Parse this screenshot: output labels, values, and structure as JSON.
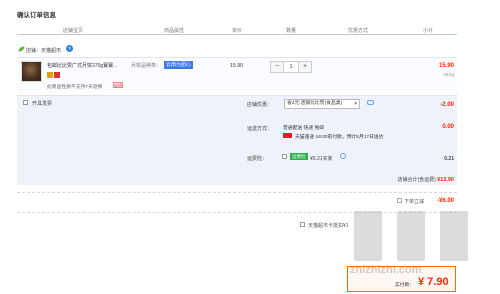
{
  "page": {
    "title": "确认订单信息",
    "columns": [
      "店铺宝贝",
      "商品属性",
      "单价",
      "数量",
      "优惠方式",
      "小计"
    ]
  },
  "store": {
    "label": "店铺：天猫超市",
    "badge": "?"
  },
  "item": {
    "name": "包邮比比赞广式月饼270g寶寶...",
    "no7": "此商品性质不支持7天退换",
    "no7_flag": "说明",
    "spec_label": "月饼品种类：",
    "spec_value": "云南为团心",
    "unit_price": "15.90",
    "quantity": "1",
    "minus": "−",
    "plus": "+",
    "subtotal": "15.90",
    "weight": "342g"
  },
  "options": {
    "invoice_label": "开具发票",
    "discount_label": "店铺优惠：",
    "discount_select": "省2元:店铺比比赞(食品类)",
    "discount_value": "-2.00",
    "shipping_label": "运送方式：",
    "shipping_main": "普通配送 快递 免邮",
    "shipping_sub": "天猫速递 16:00前付款，预计8月17日送达",
    "shipping_value": "0.00",
    "freight_label": "运费险：",
    "freight_badge": "运费险",
    "freight_text": "¥0.21买家",
    "freight_value": "0.21",
    "total_label": "店铺合计(含运费)",
    "total_value": "¥13.90"
  },
  "summary": {
    "instant_label": "下单立减",
    "instant_value": "-¥6.00",
    "card_label": "天猫超市卡抵扣¥1",
    "pay_label": "实付款：",
    "pay_value": "¥ 7.90",
    "watermark": "zhizhizhi.com"
  },
  "colors": {
    "accent_red": "#ff2a00",
    "blue": "#3b78e7",
    "green": "#2bb24c",
    "orange_border": "#ff6a00"
  }
}
